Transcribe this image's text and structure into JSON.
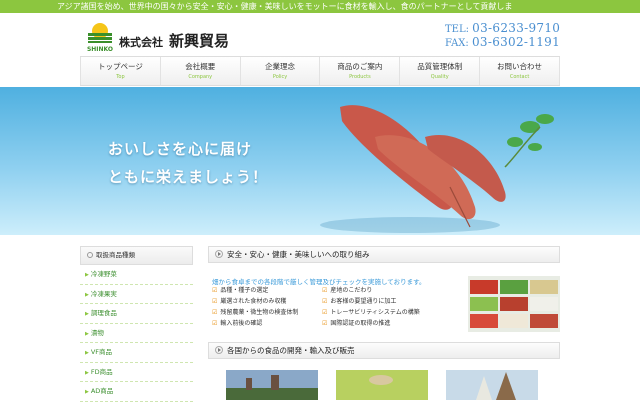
{
  "topbar": {
    "text": "アジア諸国を始め、世界中の国々から安全・安心・健康・美味しいをモットーに食材を輸入し、食のパートナーとして貢献しま"
  },
  "header": {
    "logo_text": "SHINKO",
    "company_prefix": "株式会社",
    "company_name": "新興貿易",
    "tel_label": "TEL:",
    "tel": "03-6233-9710",
    "fax_label": "FAX:",
    "fax": "03-6302-1191"
  },
  "nav": [
    {
      "jp": "トップページ",
      "en": "Top"
    },
    {
      "jp": "会社概要",
      "en": "Company"
    },
    {
      "jp": "企業理念",
      "en": "Policy"
    },
    {
      "jp": "商品のご案内",
      "en": "Products"
    },
    {
      "jp": "品質管理体制",
      "en": "Quality"
    },
    {
      "jp": "お問い合わせ",
      "en": "Contact"
    }
  ],
  "hero": {
    "line1": "おいしさを心に届け",
    "line2": "ともに栄えましょう！"
  },
  "sidebar": {
    "title": "取扱商品種類",
    "items": [
      "冷凍野菜",
      "冷凍果実",
      "調理食品",
      "漬物",
      "VF商品",
      "FD商品",
      "AD商品"
    ]
  },
  "section1": {
    "title": "安全・安心・健康・美味しいへの取り組み",
    "lead": "畑から食卓までの各段階で厳しく管理及びチェックを実施しております。",
    "points": [
      "品種・種子の選定",
      "産地のこだわり",
      "厳選された食材のみ収穫",
      "お客様の要望通りに加工",
      "残留農薬・微生物の検査体制",
      "トレーサビリティシステムの構築",
      "輸入前後の確認",
      "国際認証の取得の推進"
    ]
  },
  "section2": {
    "title": "各国からの食品の開発・輸入及び販売"
  },
  "colors": {
    "accent_green": "#8cc63f",
    "blue_text": "#3a9ad9",
    "sky": "#4fb0e0"
  }
}
